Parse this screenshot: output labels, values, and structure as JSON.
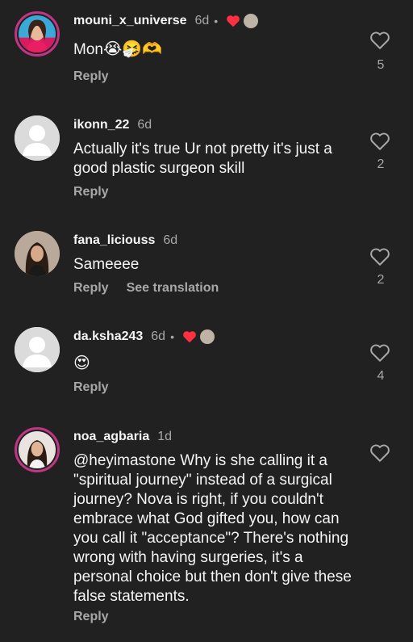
{
  "comments": [
    {
      "username": "mouni_x_universe",
      "time": "6d",
      "text": "Mon",
      "emojis": "😭🤧🫶",
      "reply": "Reply",
      "likes": "5",
      "author_liked": true
    },
    {
      "username": "ikonn_22",
      "time": "6d",
      "text": "Actually it's true Ur not pretty it's just a good plastic surgeon skill",
      "reply": "Reply",
      "likes": "2"
    },
    {
      "username": "fana_liciouss",
      "time": "6d",
      "text": "Sameeee",
      "reply": "Reply",
      "see_translation": "See translation",
      "likes": "2"
    },
    {
      "username": "da.ksha243",
      "time": "6d",
      "text": "😍",
      "reply": "Reply",
      "likes": "4",
      "author_liked": true
    },
    {
      "username": "noa_agbaria",
      "time": "1d",
      "text": "@heyimastone Why is she calling it a \"spiritual journey\" instead of a surgical journey? Nova is right, if you couldn't embrace what God gifted you, how can you call it \"acceptance\"? There's nothing wrong with having surgeries, it's a personal choice but then don't give these false statements.",
      "reply": "Reply"
    }
  ],
  "colors": {
    "background": "#212121",
    "text": "#f5f5f5",
    "secondary": "#a8a8a8",
    "like_red": "#ff3040",
    "story_ring": "#c13584"
  },
  "icons": {
    "like": "heart-outline-icon",
    "author_like": "heart-filled-icon",
    "default_avatar": "default-avatar-icon"
  }
}
